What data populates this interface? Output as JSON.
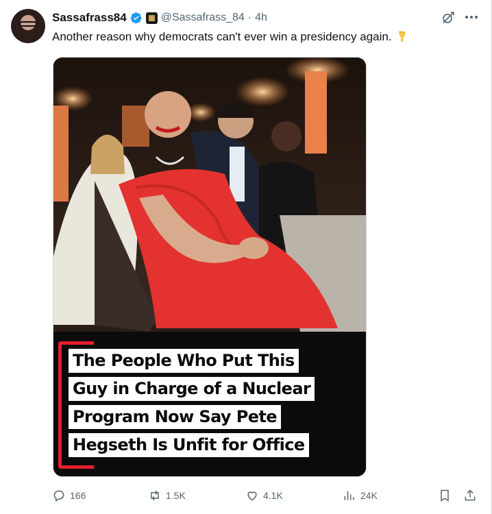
{
  "tweet": {
    "author": {
      "display_name": "Sassafrass84",
      "handle": "@Sassafrass_84",
      "separator": "·",
      "time": "4h",
      "verified": true
    },
    "text": "Another reason why democrats can't ever win a presidency again.",
    "emoji": "pointing-down-hand",
    "media": {
      "caption_lines": [
        "The People Who Put This",
        "Guy in Charge of a Nuclear",
        "Program Now Say Pete",
        "Hegseth Is Unfit for Office"
      ]
    },
    "metrics": {
      "replies": "166",
      "reposts": "1.5K",
      "likes": "4.1K",
      "views": "24K"
    }
  },
  "icons": {
    "verified": "verified-badge-icon",
    "affiliation": "affiliation-badge-icon",
    "grok": "grok-icon",
    "more": "more-icon",
    "reply": "reply-icon",
    "repost": "repost-icon",
    "like": "like-icon",
    "views": "views-icon",
    "bookmark": "bookmark-icon",
    "share": "share-icon"
  },
  "colors": {
    "accent": "#1d9bf0",
    "muted_text": "#536471",
    "caption_bracket": "#e61e2b"
  }
}
